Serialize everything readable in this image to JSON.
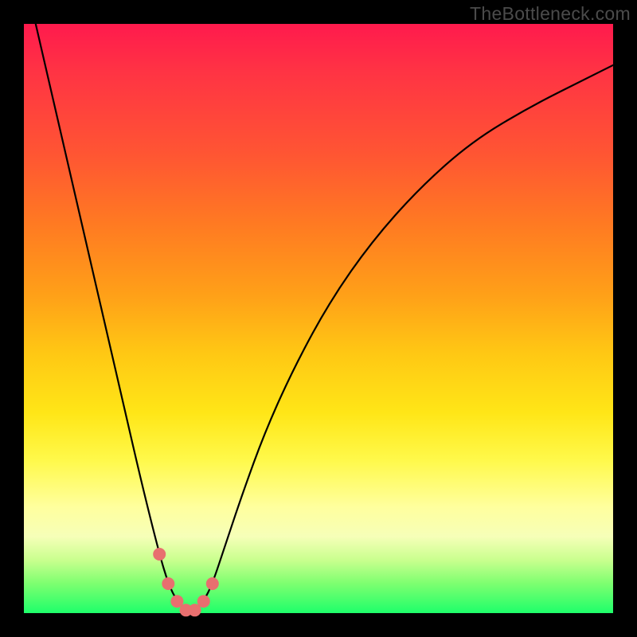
{
  "watermark": "TheBottleneck.com",
  "chart_data": {
    "type": "line",
    "title": "",
    "xlabel": "",
    "ylabel": "",
    "xlim": [
      0,
      100
    ],
    "ylim": [
      0,
      100
    ],
    "series": [
      {
        "name": "bottleneck-curve",
        "x": [
          2,
          5,
          8,
          11,
          14,
          17,
          20,
          23,
          24.5,
          26,
          27.5,
          29,
          30.5,
          32,
          34,
          37,
          41,
          46,
          52,
          59,
          67,
          76,
          86,
          96,
          100
        ],
        "y": [
          100,
          87,
          74,
          61,
          48,
          35,
          22,
          10,
          5,
          2,
          0.5,
          0.5,
          2,
          5,
          11,
          20,
          31,
          42,
          53,
          63,
          72,
          80,
          86,
          91,
          93
        ]
      }
    ],
    "markers": {
      "name": "highlight-points",
      "color": "#e86f6f",
      "x": [
        23,
        24.5,
        26,
        27.5,
        29,
        30.5,
        32
      ],
      "y": [
        10,
        5,
        2,
        0.5,
        0.5,
        2,
        5
      ],
      "size": 8
    },
    "gradient_stops": [
      {
        "pos": 0.0,
        "color": "#ff1a4d"
      },
      {
        "pos": 0.08,
        "color": "#ff3344"
      },
      {
        "pos": 0.22,
        "color": "#ff5533"
      },
      {
        "pos": 0.34,
        "color": "#ff7a22"
      },
      {
        "pos": 0.46,
        "color": "#ffa018"
      },
      {
        "pos": 0.56,
        "color": "#ffc814"
      },
      {
        "pos": 0.66,
        "color": "#ffe617"
      },
      {
        "pos": 0.74,
        "color": "#fff94a"
      },
      {
        "pos": 0.82,
        "color": "#ffff9e"
      },
      {
        "pos": 0.87,
        "color": "#f6ffb8"
      },
      {
        "pos": 0.91,
        "color": "#c9ff8e"
      },
      {
        "pos": 0.95,
        "color": "#7dff70"
      },
      {
        "pos": 1.0,
        "color": "#1eff6a"
      }
    ]
  }
}
